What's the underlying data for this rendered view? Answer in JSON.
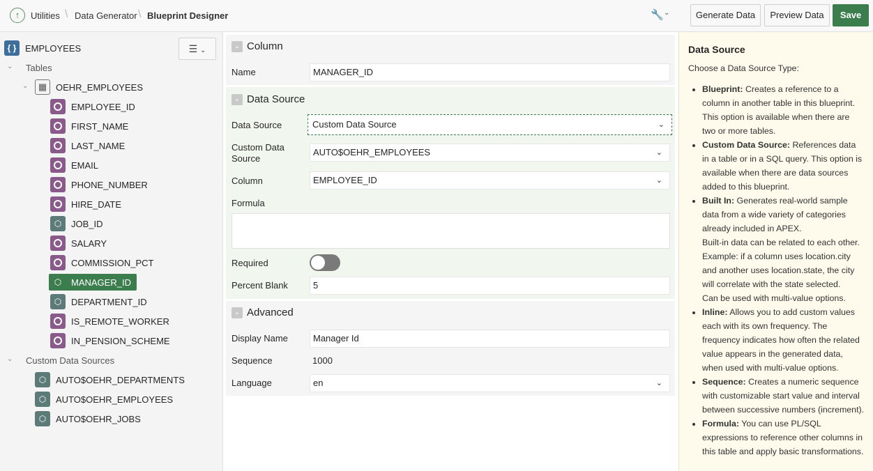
{
  "breadcrumb": {
    "home_icon": "arrow-up-icon",
    "items": [
      "Utilities",
      "Data Generator",
      "Blueprint Designer"
    ]
  },
  "toolbar": {
    "wrench_icon": "wrench-icon",
    "generate_label": "Generate Data",
    "preview_label": "Preview Data",
    "save_label": "Save"
  },
  "tree": {
    "root": "EMPLOYEES",
    "tables_label": "Tables",
    "table_name": "OEHR_EMPLOYEES",
    "columns": [
      "EMPLOYEE_ID",
      "FIRST_NAME",
      "LAST_NAME",
      "EMAIL",
      "PHONE_NUMBER",
      "HIRE_DATE",
      "JOB_ID",
      "SALARY",
      "COMMISSION_PCT",
      "MANAGER_ID",
      "DEPARTMENT_ID",
      "IS_REMOTE_WORKER",
      "IN_PENSION_SCHEME"
    ],
    "custom_sources_label": "Custom Data Sources",
    "custom_sources": [
      "AUTO$OEHR_DEPARTMENTS",
      "AUTO$OEHR_EMPLOYEES",
      "AUTO$OEHR_JOBS"
    ]
  },
  "column_region": {
    "title": "Column",
    "name_label": "Name",
    "name_value": "MANAGER_ID"
  },
  "datasource_region": {
    "title": "Data Source",
    "ds_label": "Data Source",
    "ds_value": "Custom Data Source",
    "cds_label_1": "Custom Data",
    "cds_label_2": "Source",
    "cds_value": "AUTO$OEHR_EMPLOYEES",
    "column_label": "Column",
    "column_value": "EMPLOYEE_ID",
    "formula_label": "Formula",
    "formula_value": "",
    "required_label": "Required",
    "pct_label": "Percent Blank",
    "pct_value": "5"
  },
  "advanced_region": {
    "title": "Advanced",
    "display_label": "Display Name",
    "display_value": "Manager Id",
    "seq_label": "Sequence",
    "seq_value": "1000",
    "lang_label": "Language",
    "lang_value": "en"
  },
  "help": {
    "title": "Data Source",
    "intro": "Choose a Data Source Type:",
    "items": [
      {
        "term": "Blueprint:",
        "text": " Creates a reference to a column in another table in this blueprint. This option is available when there are two or more tables."
      },
      {
        "term": "Custom Data Source:",
        "text": " References data in a table or in a SQL query. This option is available when there are data sources added to this blueprint."
      },
      {
        "term": "Built In:",
        "text": " Generates real-world sample data from a wide variety of categories already included in APEX.",
        "extra1": "Built-in data can be related to each other. Example: if a column uses location.city and another uses location.state, the city will correlate with the state selected.",
        "extra2": "Can be used with multi-value options."
      },
      {
        "term": "Inline:",
        "text": " Allows you to add custom values each with its own frequency. The frequency indicates how often the related value appears in the generated data, when used with multi-value options."
      },
      {
        "term": "Sequence:",
        "text": " Creates a numeric sequence with customizable start value and interval between successive numbers (increment)."
      },
      {
        "term": "Formula:",
        "text": " You can use PL/SQL expressions to reference other columns in this table and apply basic transformations."
      }
    ]
  },
  "colors": {
    "accent": "#3b7d4c",
    "help_bg": "#fefaec"
  }
}
